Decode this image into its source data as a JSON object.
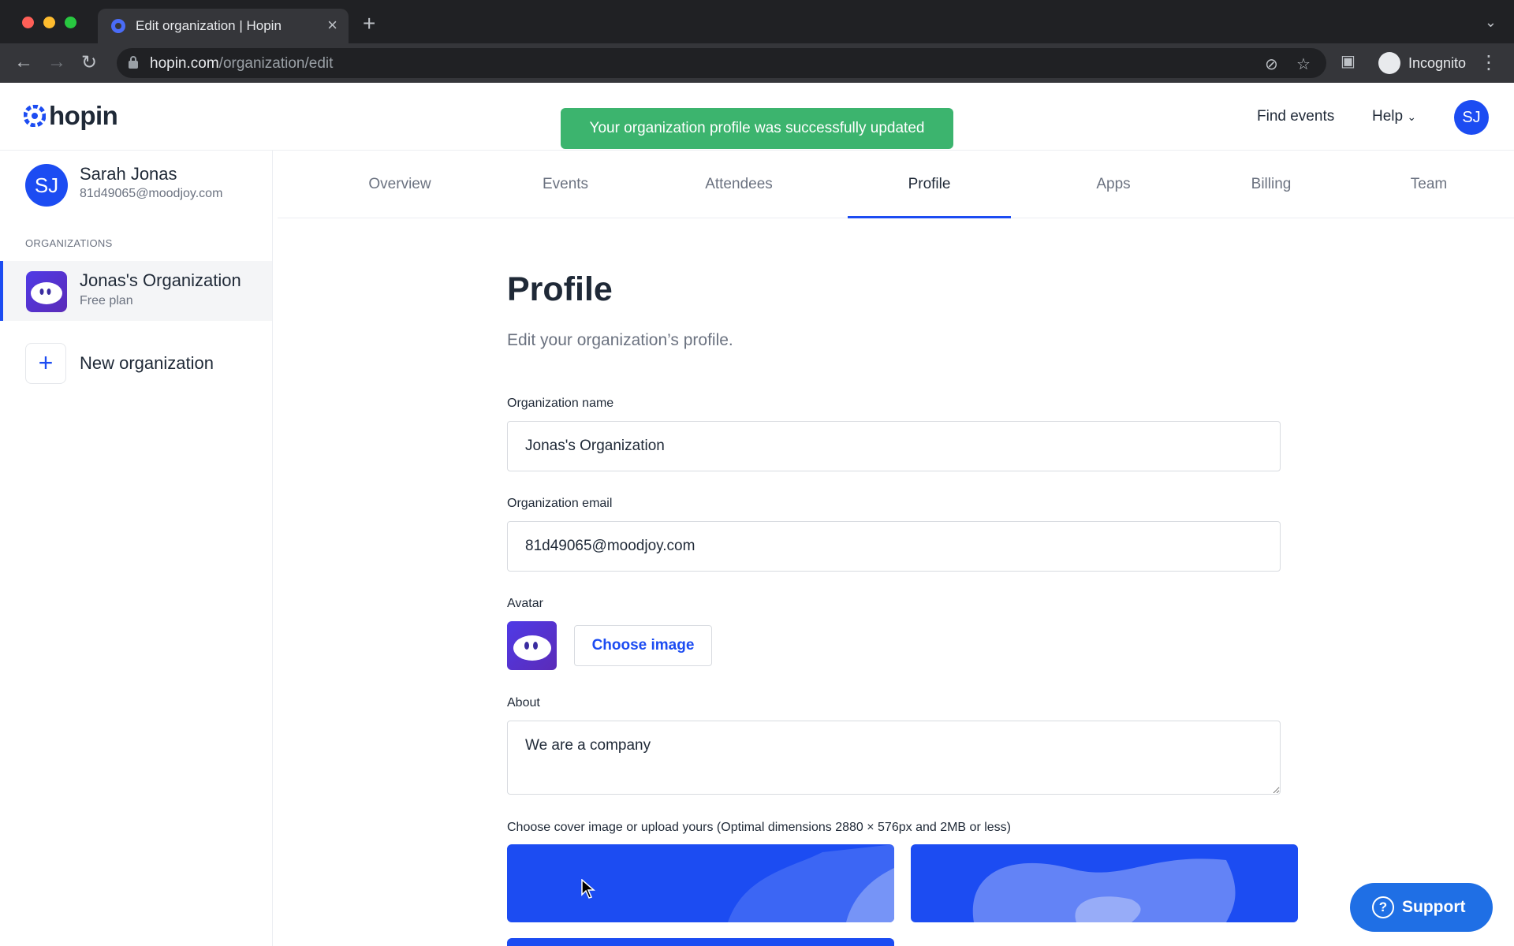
{
  "browser": {
    "tab_title": "Edit organization | Hopin",
    "url_host": "hopin.com",
    "url_path": "/organization/edit",
    "profile_label": "Incognito"
  },
  "header": {
    "logo_text": "hopin",
    "toast": "Your organization profile was successfully updated",
    "find_events": "Find events",
    "help": "Help",
    "avatar_initials": "SJ"
  },
  "sidebar": {
    "user": {
      "initials": "SJ",
      "name": "Sarah Jonas",
      "email": "81d49065@moodjoy.com"
    },
    "orgs_label": "ORGANIZATIONS",
    "org": {
      "name": "Jonas's Organization",
      "plan": "Free plan"
    },
    "new_org_label": "New organization"
  },
  "tabs": [
    {
      "label": "Overview"
    },
    {
      "label": "Events"
    },
    {
      "label": "Attendees"
    },
    {
      "label": "Profile"
    },
    {
      "label": "Apps"
    },
    {
      "label": "Billing"
    },
    {
      "label": "Team"
    }
  ],
  "main": {
    "title": "Profile",
    "subtitle": "Edit your organization’s profile.",
    "org_name_label": "Organization name",
    "org_name_value": "Jonas's Organization",
    "org_email_label": "Organization email",
    "org_email_value": "81d49065@moodjoy.com",
    "avatar_label": "Avatar",
    "choose_image": "Choose image",
    "about_label": "About",
    "about_value": "We are a company",
    "cover_label": "Choose cover image or upload yours (Optimal dimensions 2880 × 576px and 2MB or less)"
  },
  "support_label": "Support",
  "colors": {
    "accent": "#1c4cf2",
    "toast": "#3cb46e",
    "support": "#1f6fe5"
  }
}
